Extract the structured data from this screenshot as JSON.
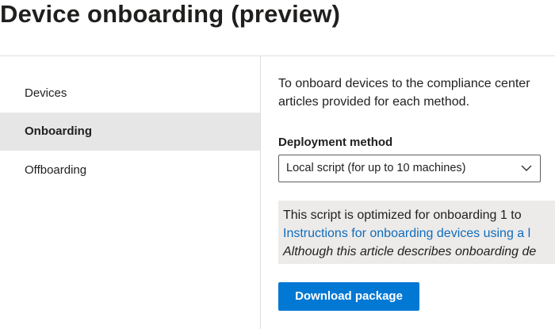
{
  "page": {
    "title": "Device onboarding (preview)"
  },
  "sidebar": {
    "items": [
      {
        "label": "Devices",
        "selected": false
      },
      {
        "label": "Onboarding",
        "selected": true
      },
      {
        "label": "Offboarding",
        "selected": false
      }
    ]
  },
  "main": {
    "intro_line1": "To onboard devices to the compliance center",
    "intro_line2": "articles provided for each method.",
    "deployment": {
      "label": "Deployment method",
      "selected_value": "Local script (for up to 10 machines)",
      "icon": "chevron-down-icon"
    },
    "info": {
      "text": "This script is optimized for onboarding 1 to",
      "link": "Instructions for onboarding devices using a l",
      "note": "Although this article describes onboarding de"
    },
    "download_label": "Download package"
  },
  "colors": {
    "accent": "#0078d4",
    "link": "#0f6cbd",
    "selected_bg": "#e6e6e6",
    "info_bg": "#edebe9"
  }
}
